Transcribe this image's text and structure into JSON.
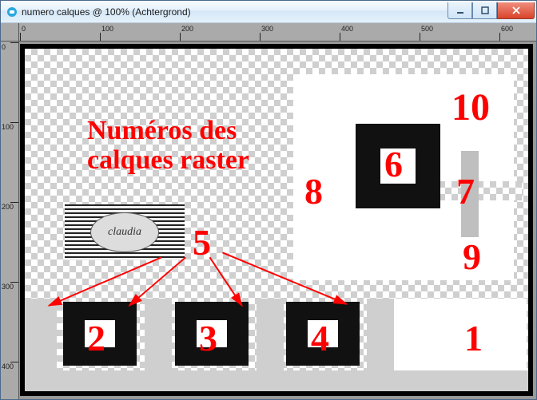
{
  "window": {
    "title": "numero calques @ 100% (Achtergrond)"
  },
  "ruler": {
    "h": [
      "0",
      "100",
      "200",
      "300",
      "400",
      "500",
      "600"
    ],
    "v": [
      "0",
      "100",
      "200",
      "300",
      "400"
    ]
  },
  "heading": {
    "line1": "Numéros des",
    "line2": "calques raster"
  },
  "logo": {
    "text": "claudia"
  },
  "labels": {
    "n1": "1",
    "n2": "2",
    "n3": "3",
    "n4": "4",
    "n5": "5",
    "n6": "6",
    "n7": "7",
    "n8": "8",
    "n9": "9",
    "n10": "10"
  }
}
